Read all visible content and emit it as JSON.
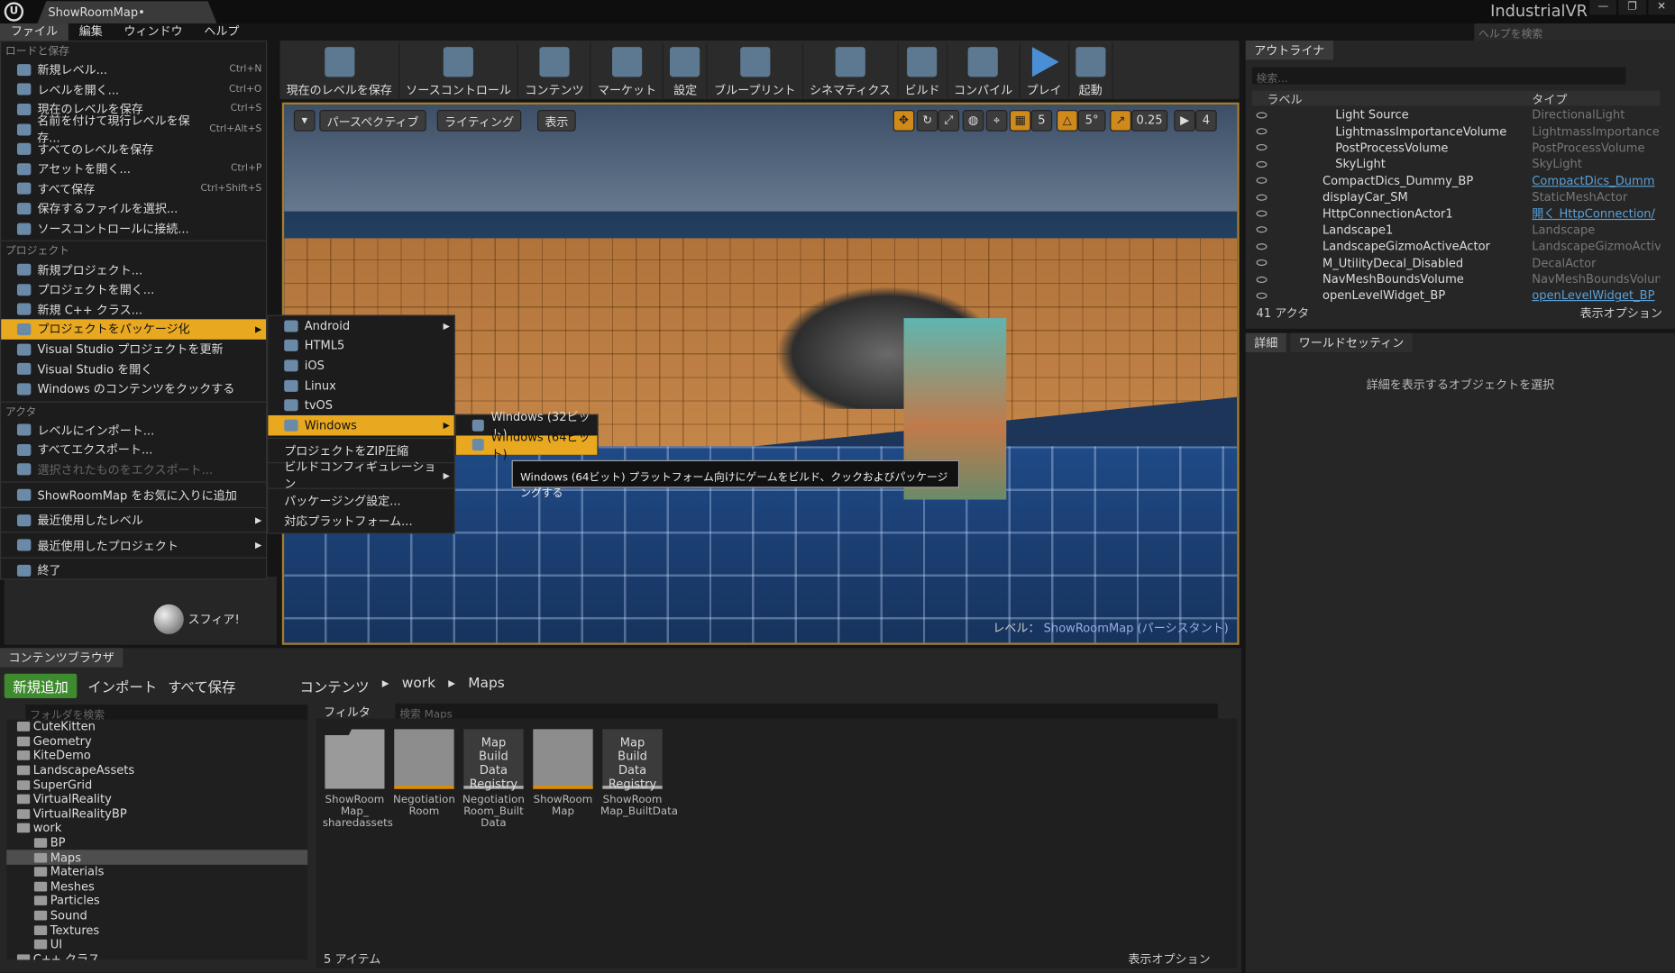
{
  "window": {
    "tab": "ShowRoomMap•",
    "app_title": "IndustrialVR",
    "help_search": "ヘルプを検索",
    "buttons": [
      "—",
      "❐",
      "✕"
    ]
  },
  "menubar": [
    "ファイル",
    "編集",
    "ウィンドウ",
    "ヘルプ"
  ],
  "toolbar": [
    "現在のレベルを保存",
    "ソースコントロール",
    "コンテンツ",
    "マーケット",
    "設定",
    "ブループリント",
    "シネマティクス",
    "ビルド",
    "コンパイル",
    "プレイ",
    "起動"
  ],
  "viewport": {
    "perspective": "パースペクティブ",
    "lighting": "ライティング",
    "show": "表示",
    "grid": "5",
    "angle": "5°",
    "scale": "0.25",
    "speed": "4",
    "level_label": "レベル：",
    "level_name": "ShowRoomMap (パーシスタント)"
  },
  "file_menu": {
    "h1": "ロードと保存",
    "items1": [
      {
        "l": "新規レベル...",
        "s": "Ctrl+N"
      },
      {
        "l": "レベルを開く...",
        "s": "Ctrl+O"
      },
      {
        "l": "現在のレベルを保存",
        "s": "Ctrl+S"
      },
      {
        "l": "名前を付けて現行レベルを保存...",
        "s": "Ctrl+Alt+S"
      },
      {
        "l": "すべてのレベルを保存",
        "s": ""
      },
      {
        "l": "アセットを開く...",
        "s": "Ctrl+P"
      },
      {
        "l": "すべて保存",
        "s": "Ctrl+Shift+S"
      },
      {
        "l": "保存するファイルを選択...",
        "s": ""
      },
      {
        "l": "ソースコントロールに接続...",
        "s": ""
      }
    ],
    "h2": "プロジェクト",
    "items2": [
      "新規プロジェクト...",
      "プロジェクトを開く...",
      "新規 C++ クラス...",
      "プロジェクトをパッケージ化",
      "Visual Studio プロジェクトを更新",
      "Visual Studio を開く",
      "Windows のコンテンツをクックする"
    ],
    "h3": "アクタ",
    "items3": [
      "レベルにインポート...",
      "すべてエクスポート...",
      "選択されたものをエクスポート..."
    ],
    "fav": "ShowRoomMap をお気に入りに追加",
    "recent_levels": "最近使用したレベル",
    "recent_projects": "最近使用したプロジェクト",
    "exit": "終了"
  },
  "package_submenu": [
    "Android",
    "HTML5",
    "iOS",
    "Linux",
    "tvOS",
    "Windows",
    "プロジェクトをZIP圧縮",
    "ビルドコンフィギュレーション",
    "パッケージング設定...",
    "対応プラットフォーム..."
  ],
  "windows_submenu": [
    "Windows (32ビット)",
    "Windows (64ビット)"
  ],
  "tooltip": "Windows (64ビット) プラットフォーム向けにゲームをビルド、クックおよびパッケージングする",
  "outliner": {
    "tab": "アウトライナ",
    "search": "検索...",
    "col_label": "ラベル",
    "col_type": "タイプ",
    "rows": [
      {
        "n": "Light Source",
        "t": "DirectionalLight",
        "c": 0
      },
      {
        "n": "LightmassImportanceVolume",
        "t": "LightmassImportanceV",
        "c": 0
      },
      {
        "n": "PostProcessVolume",
        "t": "PostProcessVolume",
        "c": 0
      },
      {
        "n": "SkyLight",
        "t": "SkyLight",
        "c": 0
      },
      {
        "n": "CompactDics_Dummy_BP",
        "t": "CompactDics_Dumm",
        "c": 1
      },
      {
        "n": "displayCar_SM",
        "t": "StaticMeshActor",
        "c": 0
      },
      {
        "n": "HttpConnectionActor1",
        "t": "開く HttpConnection/",
        "c": 1
      },
      {
        "n": "Landscape1",
        "t": "Landscape",
        "c": 0
      },
      {
        "n": "LandscapeGizmoActiveActor",
        "t": "LandscapeGizmoActiv",
        "c": 0
      },
      {
        "n": "M_UtilityDecal_Disabled",
        "t": "DecalActor",
        "c": 0
      },
      {
        "n": "NavMeshBoundsVolume",
        "t": "NavMeshBoundsVolun",
        "c": 0
      },
      {
        "n": "openLevelWidget_BP",
        "t": "openLevelWidget_BP",
        "c": 1
      }
    ],
    "count": "41 アクタ",
    "view_options": "表示オプション"
  },
  "details": {
    "tab": "詳細",
    "tab2": "ワールドセッティン",
    "message": "詳細を表示するオブジェクトを選択"
  },
  "left_panel": {
    "label": "スフィア!"
  },
  "content_browser": {
    "tab": "コンテンツブラウザ",
    "add": "新規追加",
    "import": "インポート",
    "save_all": "すべて保存",
    "crumbs": [
      "コンテンツ",
      "work",
      "Maps"
    ],
    "folder_search": "フォルダを検索",
    "filter": "フィルタ",
    "asset_search": "検索 Maps",
    "tree": [
      {
        "n": "CuteKitten",
        "d": 0
      },
      {
        "n": "Geometry",
        "d": 0
      },
      {
        "n": "KiteDemo",
        "d": 0
      },
      {
        "n": "LandscapeAssets",
        "d": 0
      },
      {
        "n": "SuperGrid",
        "d": 0
      },
      {
        "n": "VirtualReality",
        "d": 0
      },
      {
        "n": "VirtualRealityBP",
        "d": 0
      },
      {
        "n": "work",
        "d": 0
      },
      {
        "n": "BP",
        "d": 1
      },
      {
        "n": "Maps",
        "d": 1
      },
      {
        "n": "Materials",
        "d": 1
      },
      {
        "n": "Meshes",
        "d": 1
      },
      {
        "n": "Particles",
        "d": 1
      },
      {
        "n": "Sound",
        "d": 1
      },
      {
        "n": "Textures",
        "d": 1
      },
      {
        "n": "UI",
        "d": 1
      },
      {
        "n": "C++ クラス",
        "d": 0
      }
    ],
    "assets": [
      {
        "n": "ShowRoom Map_ sharedassets",
        "k": "folder"
      },
      {
        "n": "Negotiation Room",
        "k": "map"
      },
      {
        "n": "Negotiation Room_Built Data",
        "k": "mb",
        "t": "Map Build Data Registry"
      },
      {
        "n": "ShowRoom Map",
        "k": "map"
      },
      {
        "n": "ShowRoom Map_BuiltData",
        "k": "mb",
        "t": "Map Build Data Registry"
      }
    ],
    "count": "5 アイテム",
    "view_options": "表示オプション"
  }
}
